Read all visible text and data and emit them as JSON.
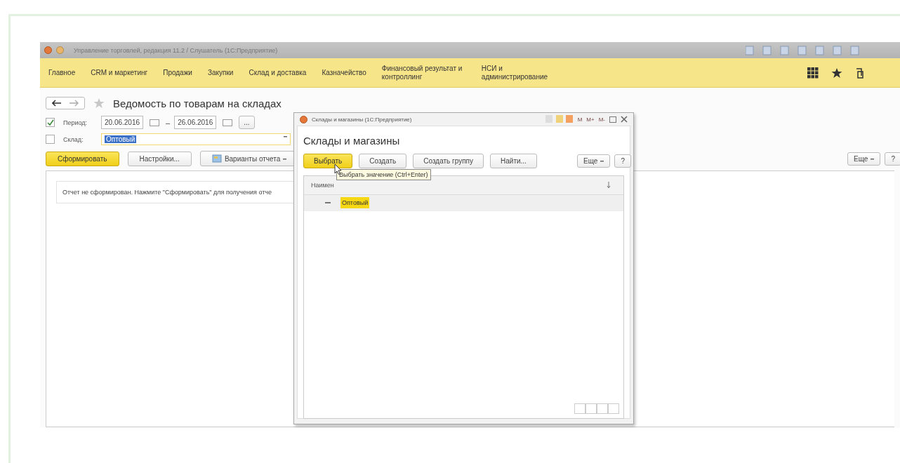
{
  "window": {
    "title": "Управление торговлей, редакция 11.2 / Слушатель (1С:Предприятие)"
  },
  "menu": [
    {
      "label": "Главное"
    },
    {
      "label": "CRM и маркетинг"
    },
    {
      "label": "Продажи"
    },
    {
      "label": "Закупки"
    },
    {
      "label": "Склад и доставка"
    },
    {
      "label": "Казначейство"
    },
    {
      "label": "Финансовый результат и контроллинг"
    },
    {
      "label": "НСИ и администрирование"
    }
  ],
  "report": {
    "title": "Ведомость по товарам на складах",
    "period": {
      "label": "Период:",
      "checked": true,
      "from": "20.06.2016",
      "dash": "–",
      "to": "26.06.2016",
      "more": "..."
    },
    "warehouse": {
      "label": "Склад:",
      "checked": false,
      "value": "Оптовый"
    },
    "buttons": [
      {
        "label": "Сформировать",
        "kind": "default"
      },
      {
        "label": "Настройки...",
        "kind": "plain"
      },
      {
        "label": "Варианты отчета",
        "kind": "variants"
      }
    ],
    "more_button": "Еще",
    "help_button": "?",
    "message": "Отчет не сформирован. Нажмите \"Сформировать\" для получения отче"
  },
  "dialog": {
    "title": "Склады и магазины (1С:Предприятие)",
    "memory_buttons": [
      "M",
      "M+",
      "M-"
    ],
    "heading": "Склады и магазины",
    "buttons": [
      {
        "label": "Выбрать",
        "kind": "default"
      },
      {
        "label": "Создать",
        "kind": "plain"
      },
      {
        "label": "Создать группу",
        "kind": "plain"
      },
      {
        "label": "Найти...",
        "kind": "plain"
      }
    ],
    "more_button": "Еще",
    "help_button": "?",
    "column": "Наимен",
    "tooltip": "Выбрать значение (Ctrl+Enter)",
    "rows": [
      {
        "name": "Оптовый",
        "selected": true
      }
    ]
  }
}
